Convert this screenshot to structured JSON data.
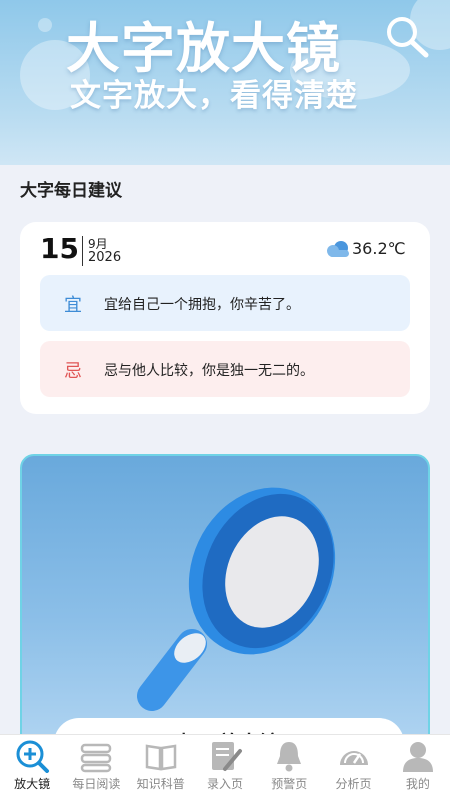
{
  "banner": {
    "title": "大字放大镜",
    "subtitle": "文字放大，看得清楚"
  },
  "section_title": "大字每日建议",
  "advice": {
    "day": "15",
    "month": "9月",
    "year": "2026",
    "temperature": "36.2℃",
    "weather_icon": "cloud-icon",
    "good": {
      "tag": "宜",
      "text": "宜给自己一个拥抱，你辛苦了。"
    },
    "bad": {
      "tag": "忌",
      "text": "忌与他人比较，你是独一无二的。"
    }
  },
  "magnifier_card": {
    "button_label": "打开放大镜"
  },
  "tabs": [
    {
      "label": "放大镜",
      "icon": "magnifier-plus-icon",
      "active": true
    },
    {
      "label": "每日阅读",
      "icon": "reading-icon",
      "active": false
    },
    {
      "label": "知识科普",
      "icon": "book-icon",
      "active": false
    },
    {
      "label": "录入页",
      "icon": "edit-document-icon",
      "active": false
    },
    {
      "label": "预警页",
      "icon": "bell-icon",
      "active": false
    },
    {
      "label": "分析页",
      "icon": "gauge-icon",
      "active": false
    },
    {
      "label": "我的",
      "icon": "user-icon",
      "active": false
    }
  ],
  "colors": {
    "accent": "#3e8cd6",
    "good_bg": "#e8f2fd",
    "bad_bg": "#fdeeee",
    "bad_text": "#e05555",
    "banner_top": "#8fc8ea"
  }
}
